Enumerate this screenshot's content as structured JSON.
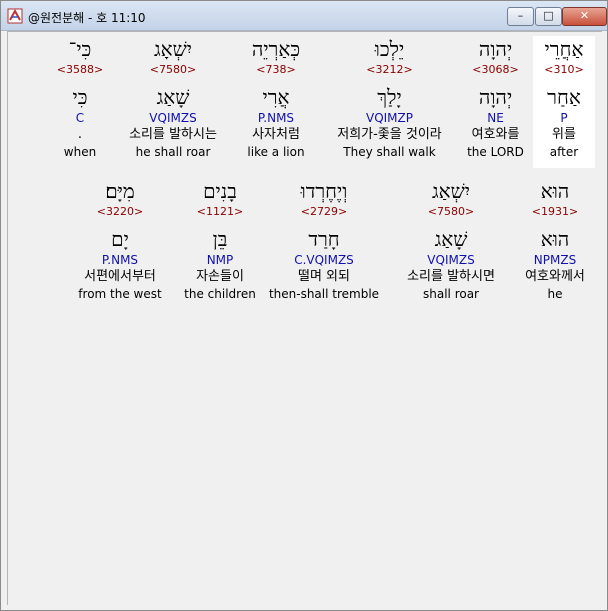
{
  "window": {
    "title": "@원전분해 - 호 11:10",
    "minimize": "–",
    "maximize": "□",
    "close": "✕"
  },
  "rows": [
    {
      "words": [
        {
          "hebrew": "אַחֲרֵי",
          "strong": "<310>",
          "lemma": "אַחַר",
          "parse": "P",
          "korean": "위를",
          "english": "after",
          "highlight": true
        },
        {
          "hebrew": "יְהוָה",
          "strong": "<3068>",
          "lemma": "יְהוָה",
          "parse": "NE",
          "korean": "여호와를",
          "english": "the LORD",
          "highlight": false
        },
        {
          "hebrew": "יֵלְכוּ",
          "strong": "<3212>",
          "lemma": "יָלַךְ",
          "parse": "VQIMZP",
          "korean": "저희가-좇을 것이라",
          "english": "They shall walk",
          "highlight": false
        },
        {
          "hebrew": "כְּאַרְיֵה",
          "strong": "<738>",
          "lemma": "אֲרִי",
          "parse": "P.NMS",
          "korean": "사자처럼",
          "english": "like a lion",
          "highlight": false
        },
        {
          "hebrew": "יִשְׁאָג",
          "strong": "<7580>",
          "lemma": "שָׁאַג",
          "parse": "VQIMZS",
          "korean": "소리를 발하시는",
          "english": "he shall roar",
          "highlight": false
        },
        {
          "hebrew": "כִּי־",
          "strong": "<3588>",
          "lemma": "כִּי",
          "parse": "C",
          "korean": ".",
          "english": "when",
          "highlight": false
        }
      ]
    },
    {
      "words": [
        {
          "hebrew": "הוּא",
          "strong": "<1931>",
          "lemma": "הוּא",
          "parse": "NPMZS",
          "korean": "여호와께서",
          "english": "he",
          "highlight": false
        },
        {
          "hebrew": "יִשְׁאַג",
          "strong": "<7580>",
          "lemma": "שָׁאַג",
          "parse": "VQIMZS",
          "korean": "소리를 발하시면",
          "english": "shall roar",
          "highlight": false
        },
        {
          "hebrew": "וְיֶחֶרְדוּ",
          "strong": "<2729>",
          "lemma": "חָרַד",
          "parse": "C.VQIMZS",
          "korean": "떨며 외되",
          "english": "then-shall tremble",
          "highlight": false
        },
        {
          "hebrew": "בָנִים",
          "strong": "<1121>",
          "lemma": "בֵּן",
          "parse": "NMP",
          "korean": "자손들이",
          "english": "the children",
          "highlight": false
        },
        {
          "hebrew": "מִיָּם׃",
          "strong": "<3220>",
          "lemma": "יָם",
          "parse": "P.NMS",
          "korean": "서편에서부터",
          "english": "from the west",
          "highlight": false
        }
      ]
    }
  ]
}
